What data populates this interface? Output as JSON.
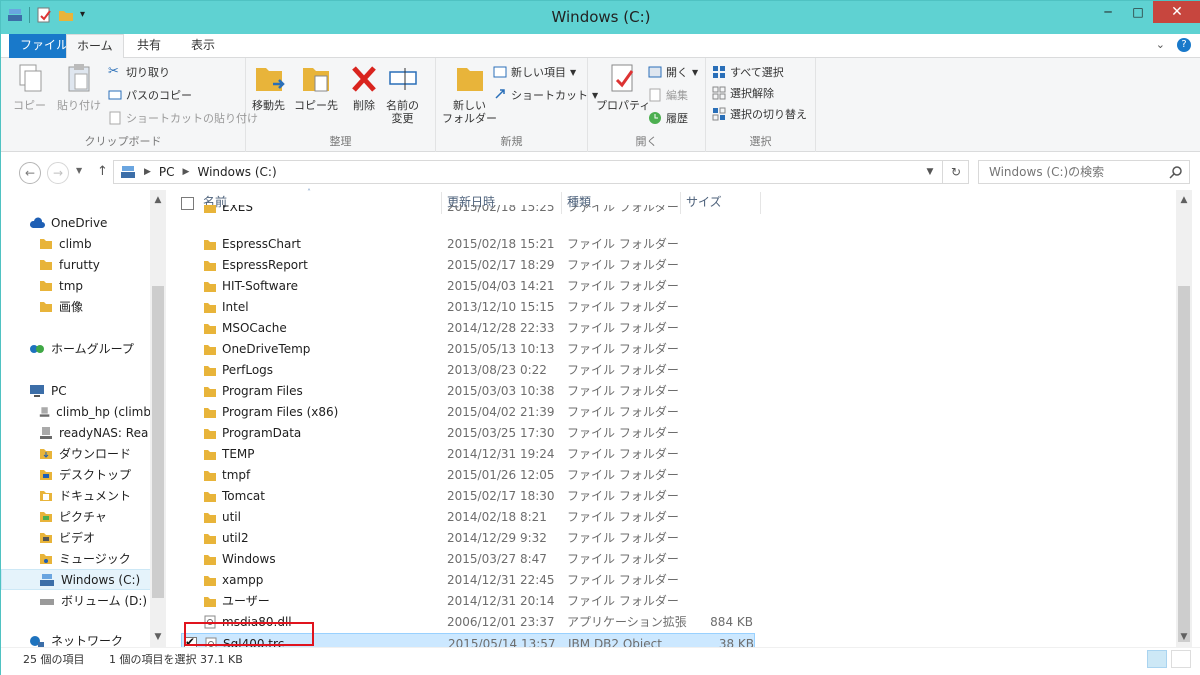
{
  "window": {
    "title": "Windows (C:)"
  },
  "ribbon_tabs": {
    "file": "ファイル",
    "home": "ホーム",
    "share": "共有",
    "view": "表示"
  },
  "ribbon": {
    "clipboard": {
      "label": "クリップボード",
      "copy": "コピー",
      "paste": "貼り付け",
      "cut": "切り取り",
      "copy_path": "パスのコピー",
      "paste_shortcut": "ショートカットの貼り付け"
    },
    "organize": {
      "label": "整理",
      "move_to": "移動先",
      "copy_to": "コピー先",
      "delete": "削除",
      "rename_line1": "名前の",
      "rename_line2": "変更"
    },
    "new": {
      "label": "新規",
      "new_folder_line1": "新しい",
      "new_folder_line2": "フォルダー",
      "new_item": "新しい項目",
      "shortcut": "ショートカット"
    },
    "open": {
      "label": "開く",
      "properties": "プロパティ",
      "open": "開く",
      "edit": "編集",
      "history": "履歴"
    },
    "select": {
      "label": "選択",
      "select_all": "すべて選択",
      "deselect": "選択解除",
      "invert": "選択の切り替え"
    }
  },
  "address": {
    "pc": "PC",
    "current": "Windows (C:)",
    "search_placeholder": "Windows (C:)の検索"
  },
  "nav": {
    "onedrive": "OneDrive",
    "onedrive_items": [
      "climb",
      "furutty",
      "tmp",
      "画像"
    ],
    "homegroup": "ホームグループ",
    "pc": "PC",
    "pc_items": [
      "climb_hp (climb",
      "readyNAS: Rea",
      "ダウンロード",
      "デスクトップ",
      "ドキュメント",
      "ピクチャ",
      "ビデオ",
      "ミュージック",
      "Windows (C:)",
      "ボリューム (D:)"
    ],
    "network": "ネットワーク"
  },
  "columns": {
    "name": "名前",
    "date": "更新日時",
    "type": "種類",
    "size": "サイズ"
  },
  "files": [
    {
      "name": "EXES",
      "date": "2015/02/18 15:25",
      "type": "ファイル フォルダー",
      "size": ""
    },
    {
      "name": "EspressChart",
      "date": "2015/02/18 15:21",
      "type": "ファイル フォルダー",
      "size": ""
    },
    {
      "name": "EspressReport",
      "date": "2015/02/17 18:29",
      "type": "ファイル フォルダー",
      "size": ""
    },
    {
      "name": "HIT-Software",
      "date": "2015/04/03 14:21",
      "type": "ファイル フォルダー",
      "size": ""
    },
    {
      "name": "Intel",
      "date": "2013/12/10 15:15",
      "type": "ファイル フォルダー",
      "size": ""
    },
    {
      "name": "MSOCache",
      "date": "2014/12/28 22:33",
      "type": "ファイル フォルダー",
      "size": ""
    },
    {
      "name": "OneDriveTemp",
      "date": "2015/05/13 10:13",
      "type": "ファイル フォルダー",
      "size": ""
    },
    {
      "name": "PerfLogs",
      "date": "2013/08/23 0:22",
      "type": "ファイル フォルダー",
      "size": ""
    },
    {
      "name": "Program Files",
      "date": "2015/03/03 10:38",
      "type": "ファイル フォルダー",
      "size": ""
    },
    {
      "name": "Program Files (x86)",
      "date": "2015/04/02 21:39",
      "type": "ファイル フォルダー",
      "size": ""
    },
    {
      "name": "ProgramData",
      "date": "2015/03/25 17:30",
      "type": "ファイル フォルダー",
      "size": ""
    },
    {
      "name": "TEMP",
      "date": "2014/12/31 19:24",
      "type": "ファイル フォルダー",
      "size": ""
    },
    {
      "name": "tmpf",
      "date": "2015/01/26 12:05",
      "type": "ファイル フォルダー",
      "size": ""
    },
    {
      "name": "Tomcat",
      "date": "2015/02/17 18:30",
      "type": "ファイル フォルダー",
      "size": ""
    },
    {
      "name": "util",
      "date": "2014/02/18 8:21",
      "type": "ファイル フォルダー",
      "size": ""
    },
    {
      "name": "util2",
      "date": "2014/12/29 9:32",
      "type": "ファイル フォルダー",
      "size": ""
    },
    {
      "name": "Windows",
      "date": "2015/03/27 8:47",
      "type": "ファイル フォルダー",
      "size": ""
    },
    {
      "name": "xampp",
      "date": "2014/12/31 22:45",
      "type": "ファイル フォルダー",
      "size": ""
    },
    {
      "name": "ユーザー",
      "date": "2014/12/31 20:14",
      "type": "ファイル フォルダー",
      "size": ""
    },
    {
      "name": "msdia80.dll",
      "date": "2006/12/01 23:37",
      "type": "アプリケーション拡張",
      "size": "884 KB"
    },
    {
      "name": "Sql400.trc",
      "date": "2015/05/14 13:57",
      "type": "IBM DB2 Object",
      "size": "38 KB"
    }
  ],
  "status": {
    "count": "25 個の項目",
    "selected": "1 個の項目を選択 37.1 KB"
  },
  "colors": {
    "titlebar": "#5fd2d2",
    "file_tab": "#1979ca",
    "close": "#c7463e",
    "folder": "#e8b43a",
    "selection": "#cce8ff",
    "highlight_box": "#e0141e"
  }
}
